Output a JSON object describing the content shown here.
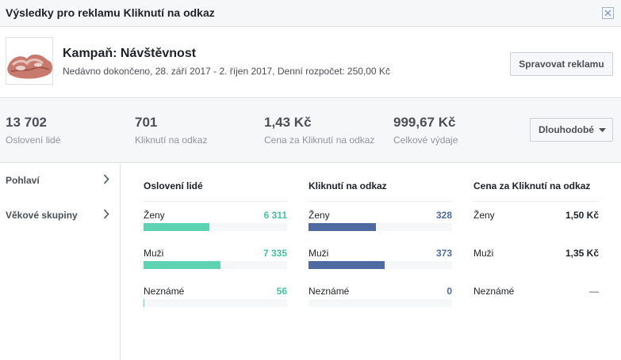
{
  "dialog": {
    "title": "Výsledky pro reklamu Kliknutí na odkaz"
  },
  "campaign": {
    "name": "Kampaň: Návštěvnost",
    "details": "Nedávno dokončeno, 28. září 2017 - 2. říjen 2017, Denní rozpočet: 250,00 Kč",
    "manage_button": "Spravovat reklamu"
  },
  "stats": [
    {
      "value": "13 702",
      "label": "Oslovení lidé"
    },
    {
      "value": "701",
      "label": "Kliknutí na odkaz"
    },
    {
      "value": "1,43 Kč",
      "label": "Cena za Kliknutí na odkaz"
    },
    {
      "value": "999,67 Kč",
      "label": "Celkové výdaje"
    }
  ],
  "range_button": "Dlouhodobé",
  "sidebar": {
    "items": [
      {
        "label": "Pohlaví"
      },
      {
        "label": "Věkové skupiny"
      }
    ]
  },
  "breakdown": {
    "reach": {
      "header": "Oslovení lidé",
      "color": "#5dd3b3",
      "rows": [
        {
          "label": "Ženy",
          "value": "6 311",
          "share": 0.46
        },
        {
          "label": "Muži",
          "value": "7 335",
          "share": 0.535
        },
        {
          "label": "Neznámé",
          "value": "56",
          "share": 0.004
        }
      ]
    },
    "clicks": {
      "header": "Kliknutí na odkaz",
      "color": "#4f6aa0",
      "rows": [
        {
          "label": "Ženy",
          "value": "328",
          "share": 0.468
        },
        {
          "label": "Muži",
          "value": "373",
          "share": 0.532
        },
        {
          "label": "Neznámé",
          "value": "0",
          "share": 0
        }
      ]
    },
    "cost": {
      "header": "Cena za Kliknutí na odkaz",
      "rows": [
        {
          "label": "Ženy",
          "value": "1,50 Kč"
        },
        {
          "label": "Muži",
          "value": "1,35 Kč"
        },
        {
          "label": "Neznámé",
          "value": "—"
        }
      ]
    }
  }
}
